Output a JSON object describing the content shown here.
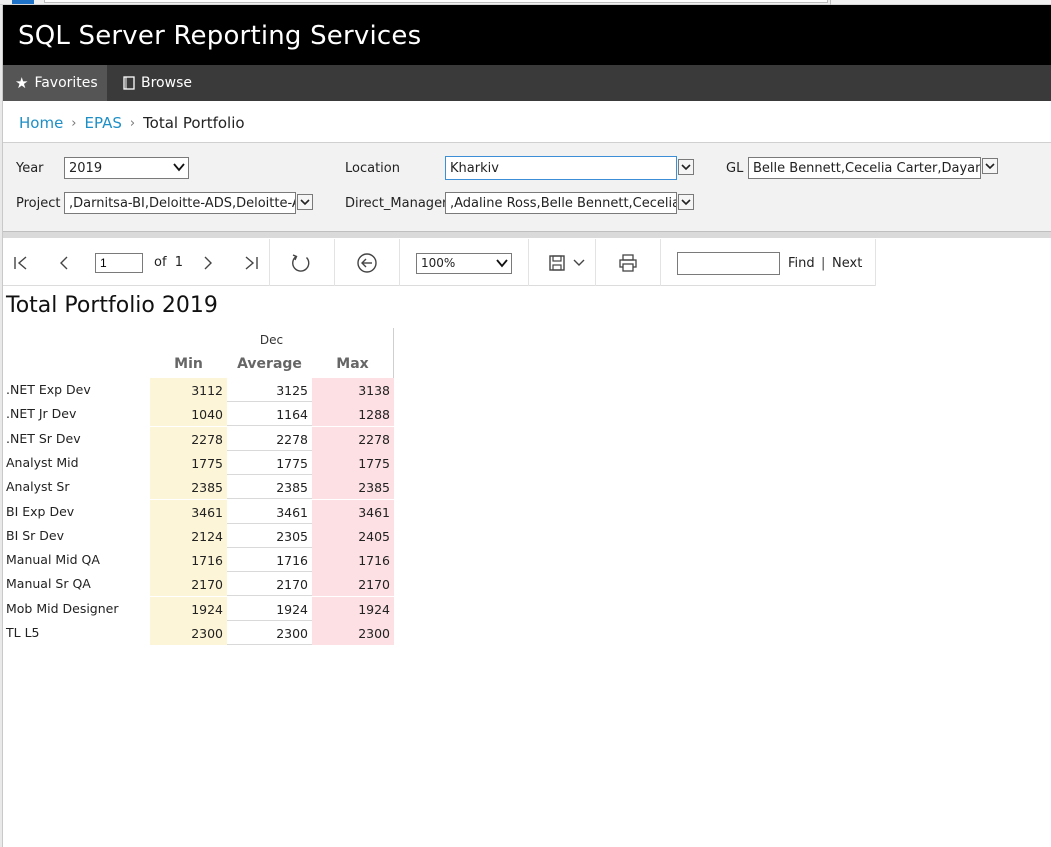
{
  "app": {
    "title": "SQL Server Reporting Services"
  },
  "nav": {
    "favorites": "Favorites",
    "browse": "Browse"
  },
  "breadcrumb": {
    "home": "Home",
    "folder": "EPAS",
    "current": "Total Portfolio"
  },
  "params": {
    "year_label": "Year",
    "year_value": "2019",
    "location_label": "Location",
    "location_value": "Kharkiv",
    "gl_label": "GL",
    "gl_value": "Belle Bennett,Cecelia Carter,Dayana Co",
    "project_label": "Project",
    "project_value": ",Darnitsa-BI,Deloitte-ADS,Deloitte-Arc",
    "manager_label": "Direct_Manager",
    "manager_value": ",Adaline Ross,Belle Bennett,Cecelia Ca"
  },
  "toolbar": {
    "page": "1",
    "of_label": "of",
    "total_pages": "1",
    "zoom": "100%",
    "find_label": "Find",
    "separator": "|",
    "next_label": "Next"
  },
  "report": {
    "title": "Total Portfolio 2019",
    "column_group": "Dec",
    "columns": [
      "Min",
      "Average",
      "Max"
    ],
    "rows": [
      {
        "label": ".NET Exp Dev",
        "min": "3112",
        "avg": "3125",
        "max": "3138"
      },
      {
        "label": ".NET Jr Dev",
        "min": "1040",
        "avg": "1164",
        "max": "1288"
      },
      {
        "label": ".NET Sr Dev",
        "min": "2278",
        "avg": "2278",
        "max": "2278"
      },
      {
        "label": "Analyst Mid",
        "min": "1775",
        "avg": "1775",
        "max": "1775"
      },
      {
        "label": "Analyst Sr",
        "min": "2385",
        "avg": "2385",
        "max": "2385"
      },
      {
        "label": "BI Exp Dev",
        "min": "3461",
        "avg": "3461",
        "max": "3461"
      },
      {
        "label": "BI Sr Dev",
        "min": "2124",
        "avg": "2305",
        "max": "2405"
      },
      {
        "label": "Manual Mid QA",
        "min": "1716",
        "avg": "1716",
        "max": "1716"
      },
      {
        "label": "Manual Sr QA",
        "min": "2170",
        "avg": "2170",
        "max": "2170"
      },
      {
        "label": "Mob Mid Designer",
        "min": "1924",
        "avg": "1924",
        "max": "1924"
      },
      {
        "label": "TL L5",
        "min": "2300",
        "avg": "2300",
        "max": "2300"
      }
    ]
  },
  "colors": {
    "header_bg": "#000000",
    "nav_bg": "#3a3a3a",
    "link": "#1e8fc6",
    "min_fill": "#fdf5d8",
    "max_fill": "#fde0e3"
  }
}
